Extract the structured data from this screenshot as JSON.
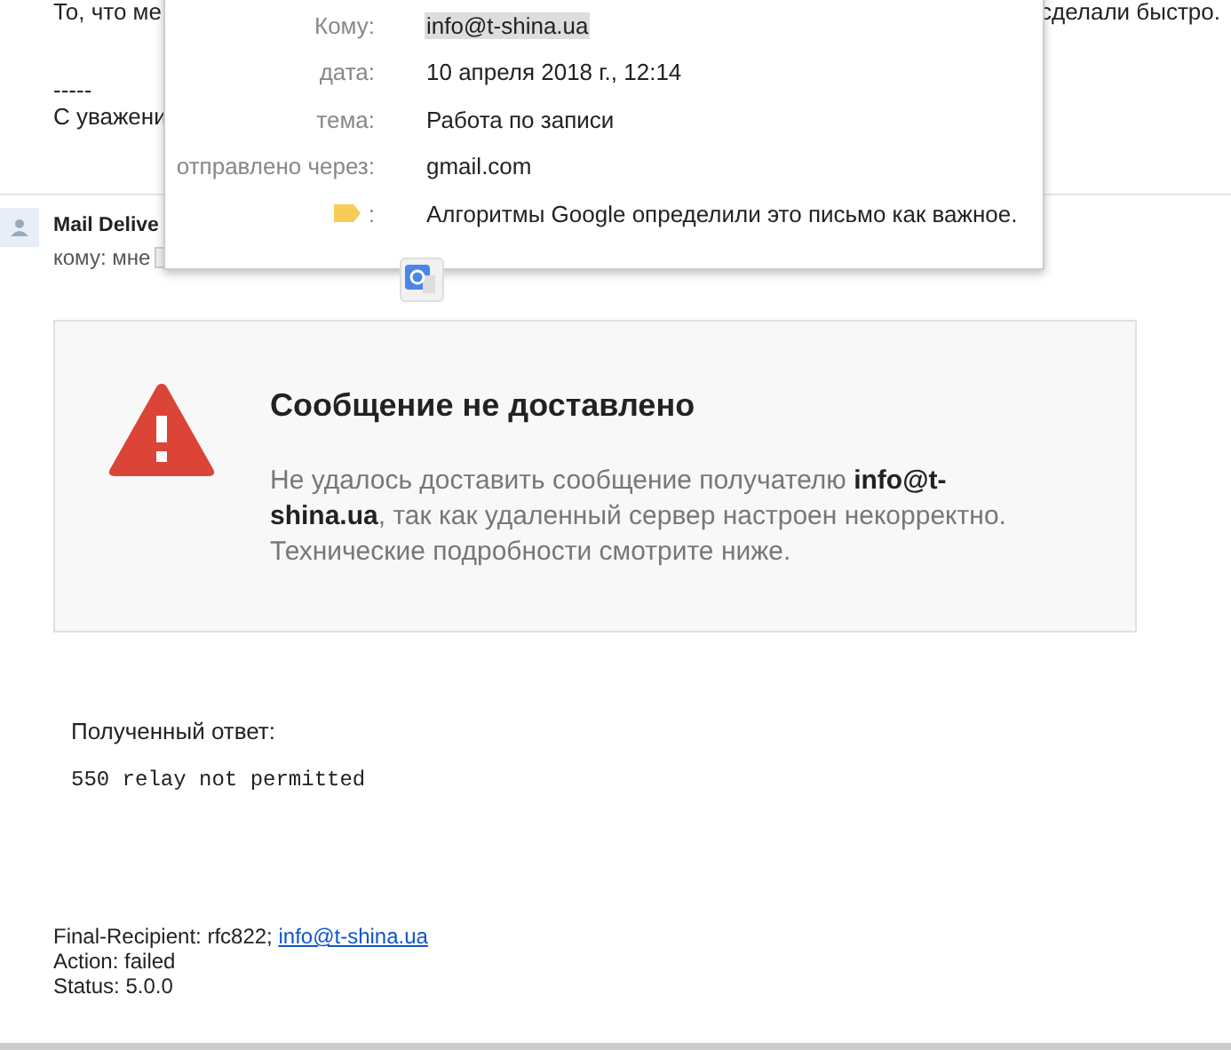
{
  "previous_message": {
    "body_start": "То, что ме",
    "body_end": "сделали быстро.",
    "separator": "-----",
    "signature": "С уважени"
  },
  "message": {
    "sender": "Mail Delive",
    "recipient": "кому: мне"
  },
  "details_popup": {
    "rows": [
      {
        "kind": "text",
        "label": "Кому:",
        "value": "info@t-shina.ua",
        "selected": true
      },
      {
        "kind": "text",
        "label": "дата:",
        "value": "10 апреля 2018 г., 12:14",
        "selected": false
      },
      {
        "kind": "text",
        "label": "тема:",
        "value": "Работа по записи",
        "selected": false
      },
      {
        "kind": "text",
        "label": "отправлено через:",
        "value": "gmail.com",
        "selected": false
      },
      {
        "kind": "importance",
        "label": ":",
        "value": "Алгоритмы Google определили это письмо как важное.",
        "selected": false
      }
    ]
  },
  "bounce_card": {
    "title": "Сообщение не доставлено",
    "text": "Не удалось доставить сообщение получателю **info@t-shina.ua**, так как удаленный сервер настроен некорректно. Технические подробности смотрите ниже."
  },
  "response": {
    "label": "Полученный ответ:",
    "code": "550 relay not permitted"
  },
  "report": {
    "recipient_prefix": "Final-Recipient: rfc822;",
    "recipient_link": "info@t-shina.ua",
    "action": "Action: failed",
    "status": "Status: 5.0.0"
  }
}
